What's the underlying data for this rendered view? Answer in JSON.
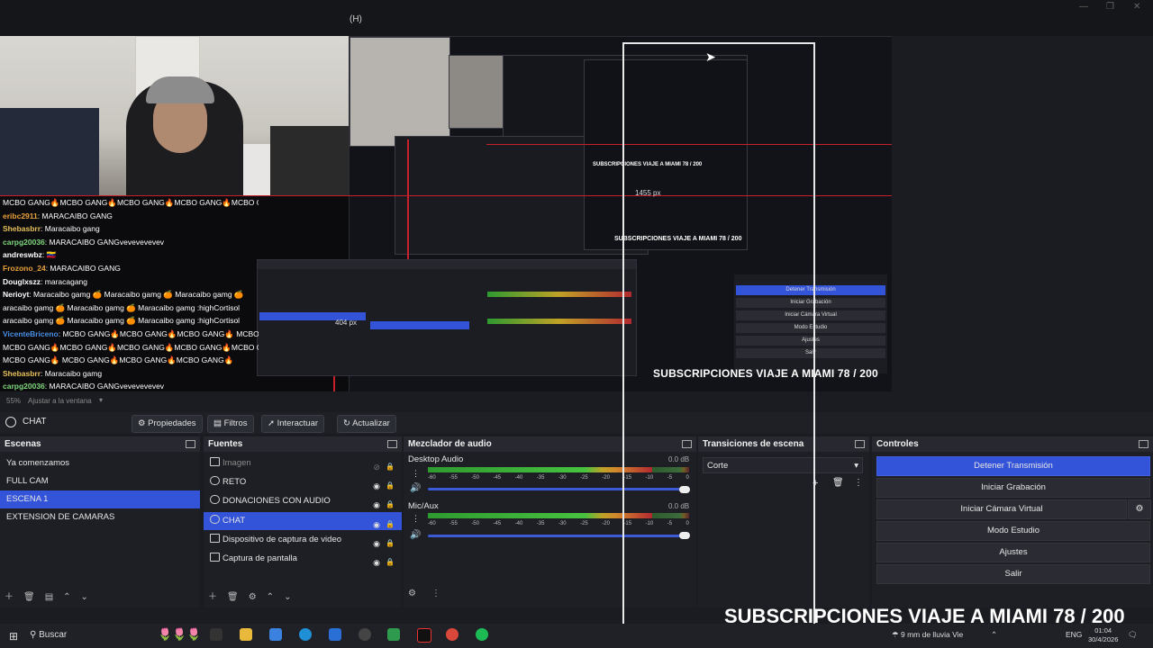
{
  "window": {
    "menu_help": "(H)"
  },
  "preview": {
    "chat_lines": [
      {
        "user": "",
        "text": "MCBO GANG🔥MCBO GANG🔥MCBO GANG🔥MCBO GANG🔥MCBO GANG🔥"
      },
      {
        "user": "eribc2911",
        "text": ": MARACAIBO GANG",
        "color": "#e9a23b"
      },
      {
        "user": "Shebasbrr",
        "text": ": Maracaibo gang",
        "color": "#e8c15a"
      },
      {
        "user": "carpg20036",
        "text": ": MARACAIBO GANGvevevevevev",
        "color": "#7fd67c"
      },
      {
        "user": "andreswbz",
        "text": ": 🇻🇪",
        "color": "#ffffff"
      },
      {
        "user": "Frozono_24",
        "text": ": MARACAIBO GANG",
        "color": "#e9a23b"
      },
      {
        "user": "Douglxszz",
        "text": ": maracagang",
        "color": "#ffffff"
      },
      {
        "user": "Nerioyt",
        "text": ": Maracaibo gamg 🍊 Maracaibo gamg 🍊 Maracaibo gamg 🍊",
        "color": "#ffffff"
      },
      {
        "user": "",
        "text": "aracaibo gamg 🍊 Maracaibo gamg 🍊 Maracaibo gamg :highCortisol"
      },
      {
        "user": "",
        "text": "aracaibo gamg 🍊 Maracaibo gamg 🍊 Maracaibo gamg :highCortisol"
      },
      {
        "user": "VicenteBriceno",
        "text": ": MCBO GANG🔥MCBO GANG🔥MCBO GANG🔥 MCBO GANG🔥",
        "color": "#4a8fe6"
      },
      {
        "user": "",
        "text": "MCBO GANG🔥MCBO GANG🔥MCBO GANG🔥MCBO GANG🔥MCBO GANG🔥"
      },
      {
        "user": "",
        "text": "MCBO GANG🔥 MCBO GANG🔥MCBO GANG🔥MCBO GANG🔥"
      },
      {
        "user": "Shebasbrr",
        "text": ": Maracaibo gamg",
        "color": "#e8c15a"
      },
      {
        "user": "carpg20036",
        "text": ": MARACAIBO GANGvevevevevev",
        "color": "#7fd67c"
      }
    ],
    "px_small": "404 px",
    "px_large": "1455 px",
    "nested_subscription": "SUBSCRIPCIONES VIAJE A MIAMI 78 / 200",
    "nested_subscription_small": "SUBSCRIPCIONES VIAJE A MIAMI 78 / 200",
    "nested_subscription_tiny": "SUBSCRIPCIONES VIAJE A MIAMI 78 / 200",
    "nested_controls": [
      "Detener Transmisión",
      "Iniciar Grabación",
      "Iniciar Cámara Virtual",
      "Modo Estudio",
      "Ajustes",
      "Salir"
    ]
  },
  "zoom": {
    "percent": "55%",
    "label": "Ajustar a la ventana"
  },
  "source_toolbar": {
    "current_source": "CHAT",
    "properties": "Propiedades",
    "filters": "Filtros",
    "interact": "Interactuar",
    "refresh": "Actualizar"
  },
  "scenes": {
    "title": "Escenas",
    "items": [
      "Ya comenzamos",
      "FULL CAM",
      "ESCENA 1",
      "EXTENSION DE CAMARAS"
    ],
    "selected_index": 2
  },
  "sources": {
    "title": "Fuentes",
    "items": [
      "Imagen",
      "RETO",
      "DONACIONES CON AUDIO",
      "CHAT",
      "Dispositivo de captura de video",
      "Captura de pantalla"
    ],
    "selected_index": 3
  },
  "mixer": {
    "title": "Mezclador de audio",
    "tracks": [
      {
        "name": "Desktop Audio",
        "db": "0.0 dB",
        "level": 0.86
      },
      {
        "name": "Mic/Aux",
        "db": "0.0 dB",
        "level": 0.86
      }
    ],
    "ticks": [
      "-60",
      "-55",
      "-50",
      "-45",
      "-40",
      "-35",
      "-30",
      "-25",
      "-20",
      "-15",
      "-10",
      "-5",
      "0"
    ]
  },
  "transitions": {
    "title": "Transiciones de escena",
    "selected": "Corte"
  },
  "controls": {
    "title": "Controles",
    "stop_stream": "Detener Transmisión",
    "start_recording": "Iniciar Grabación",
    "start_virtual_cam": "Iniciar Cámara Virtual",
    "studio_mode": "Modo Estudio",
    "settings": "Ajustes",
    "exit": "Salir"
  },
  "overlay": {
    "subscriptions": "SUBSCRIPCIONES VIAJE A MIAMI 78 / 200"
  },
  "taskbar": {
    "search_placeholder": "Buscar",
    "weather": "9 mm de lluvia Vie",
    "lang": "ENG",
    "time": "01:04",
    "date": "30/4/2026"
  },
  "colors": {
    "accent": "#3353d8",
    "record_red": "#c8202a"
  }
}
